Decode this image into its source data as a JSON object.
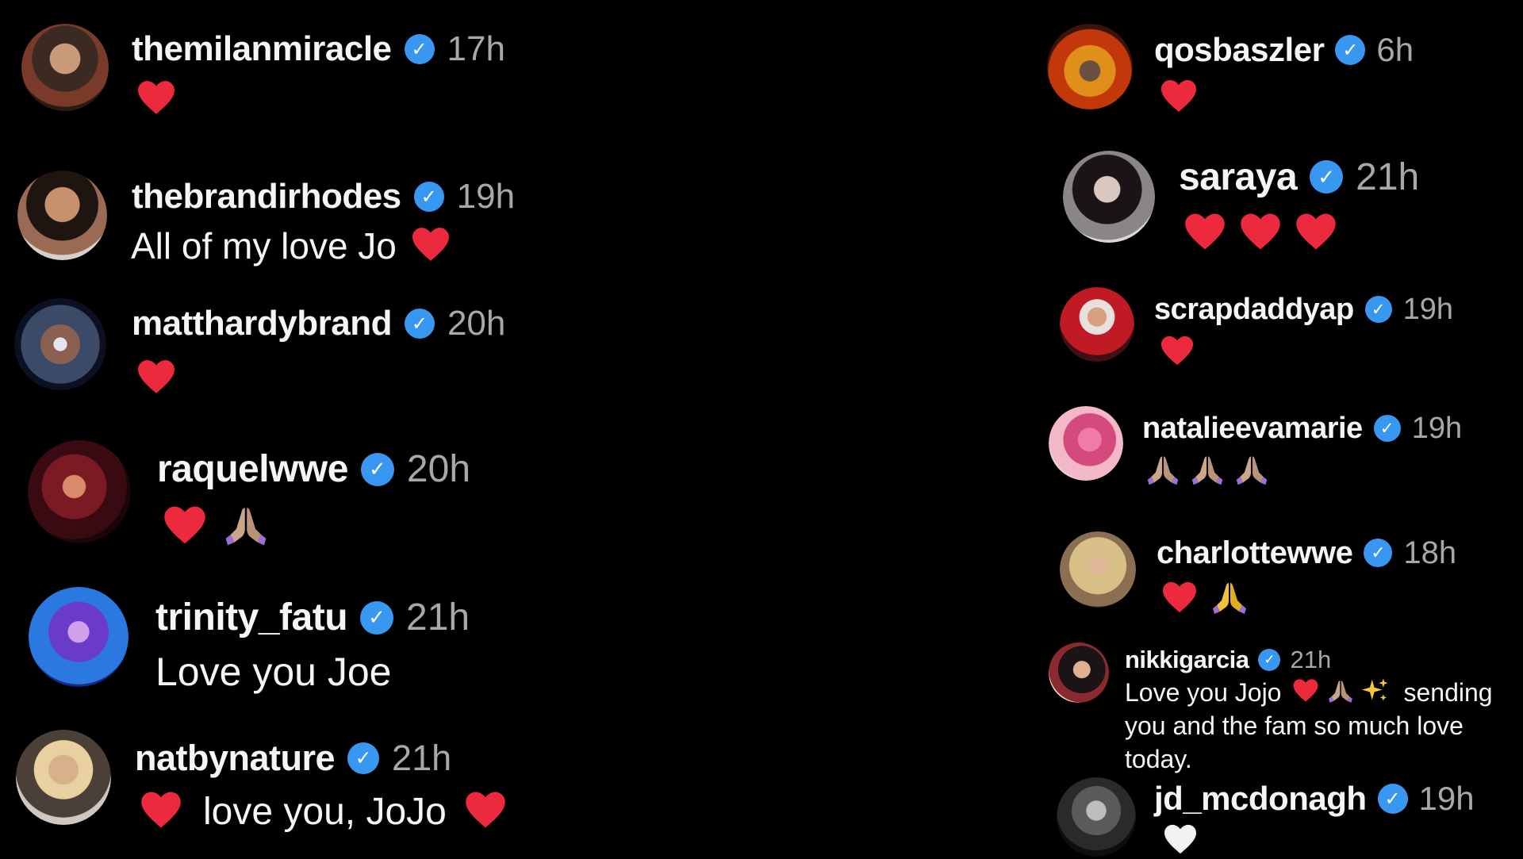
{
  "colors": {
    "background": "#000000",
    "username": "#f5f5f5",
    "timestamp": "#a8a8a8",
    "verified_badge": "#3897f0",
    "heart": "#ed2a3d",
    "white_heart": "#f2f2f2"
  },
  "left_comments": [
    {
      "username": "themilanmiracle",
      "time": "17h",
      "emojis": [
        "red-heart"
      ]
    },
    {
      "username": "thebrandirhodes",
      "time": "19h",
      "text": "All of my love Jo",
      "emojis_after": [
        "red-heart"
      ]
    },
    {
      "username": "matthardybrand",
      "time": "20h",
      "emojis": [
        "red-heart"
      ]
    },
    {
      "username": "raquelwwe",
      "time": "20h",
      "emojis": [
        "red-heart",
        "folded-hands"
      ]
    },
    {
      "username": "trinity_fatu",
      "time": "21h",
      "text": "Love you Joe"
    },
    {
      "username": "natbynature",
      "time": "21h",
      "text": "love you, JoJo",
      "emojis_before": [
        "red-heart"
      ],
      "emojis_after": [
        "red-heart"
      ]
    }
  ],
  "right_comments": [
    {
      "username": "qosbaszler",
      "time": "6h",
      "emojis": [
        "red-heart"
      ]
    },
    {
      "username": "saraya",
      "time": "21h",
      "emojis": [
        "red-heart",
        "red-heart",
        "red-heart"
      ]
    },
    {
      "username": "scrapdaddyap",
      "time": "19h",
      "emojis": [
        "red-heart"
      ]
    },
    {
      "username": "natalieevamarie",
      "time": "19h",
      "emojis": [
        "folded-hands",
        "folded-hands",
        "folded-hands"
      ]
    },
    {
      "username": "charlottewwe",
      "time": "18h",
      "emojis": [
        "red-heart",
        "folded-hands"
      ]
    },
    {
      "username": "nikkigarcia",
      "time": "21h",
      "text_part1": "Love you Jojo",
      "text_part2": "sending",
      "text_line2": "you and the fam so much love",
      "text_line3": "today.",
      "emojis": [
        "red-heart",
        "folded-hands",
        "sparkles"
      ]
    },
    {
      "username": "jd_mcdonagh",
      "time": "19h",
      "emojis": [
        "white-heart"
      ]
    }
  ]
}
